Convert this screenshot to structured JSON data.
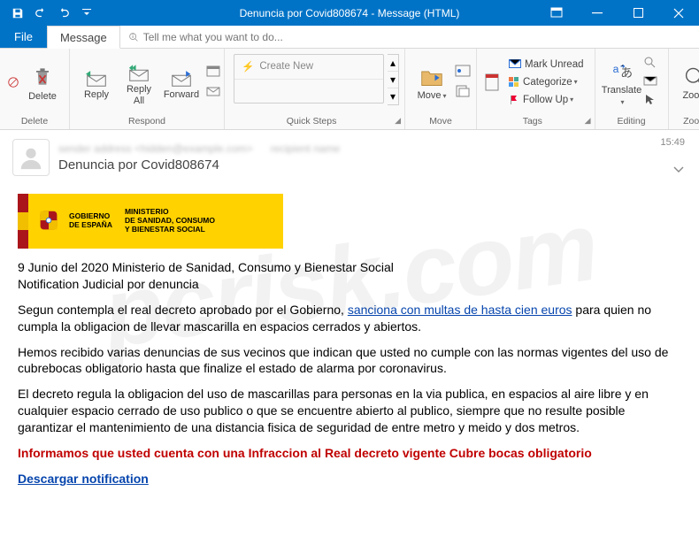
{
  "titlebar": {
    "title": "Denuncia por Covid808674 - Message (HTML)"
  },
  "tabs": {
    "file": "File",
    "message": "Message",
    "tell": "Tell me what you want to do..."
  },
  "ribbon": {
    "delete": {
      "label": "Delete",
      "group": "Delete"
    },
    "respond": {
      "reply": "Reply",
      "replyall": "Reply\nAll",
      "forward": "Forward",
      "group": "Respond"
    },
    "quicksteps": {
      "create": "Create New",
      "group": "Quick Steps"
    },
    "move": {
      "move": "Move",
      "group": "Move"
    },
    "tags": {
      "unread": "Mark Unread",
      "categorize": "Categorize",
      "followup": "Follow Up",
      "group": "Tags"
    },
    "editing": {
      "translate": "Translate",
      "group": "Editing"
    },
    "zoom": {
      "zoom": "Zoom",
      "group": "Zoom"
    }
  },
  "header": {
    "subject": "Denuncia por Covid808674",
    "time": "15:49"
  },
  "body": {
    "gov1": "GOBIERNO\nDE ESPAÑA",
    "gov2": "MINISTERIO\nDE SANIDAD, CONSUMO\nY BIENESTAR SOCIAL",
    "line1": "9 Junio del 2020 Ministerio de Sanidad, Consumo y Bienestar Social",
    "line2": "Notification Judicial por denuncia",
    "p1a": "Segun contempla el real decreto aprobado por el Gobierno, ",
    "p1link": "sanciona con multas de hasta cien euros",
    "p1b": " para quien no cumpla la obligacion de llevar mascarilla en espacios cerrados y abiertos.",
    "p2": "Hemos recibido varias denuncias de sus vecinos que indican que usted no cumple con las normas vigentes del uso de cubrebocas obligatorio hasta que finalize el estado de alarma por coronavirus.",
    "p3": "El decreto regula la obligacion del uso de mascarillas para personas en la via publica, en espacios al aire libre y en cualquier espacio cerrado de uso publico o que se encuentre abierto al publico, siempre que no resulte posible garantizar el mantenimiento de una distancia fisica de seguridad de entre metro y meido y dos metros.",
    "red": "Informamos que usted cuenta con una Infraccion al Real decreto vigente Cubre bocas obligatorio",
    "link": "Descargar notification"
  },
  "watermark": "pcrisk.com"
}
